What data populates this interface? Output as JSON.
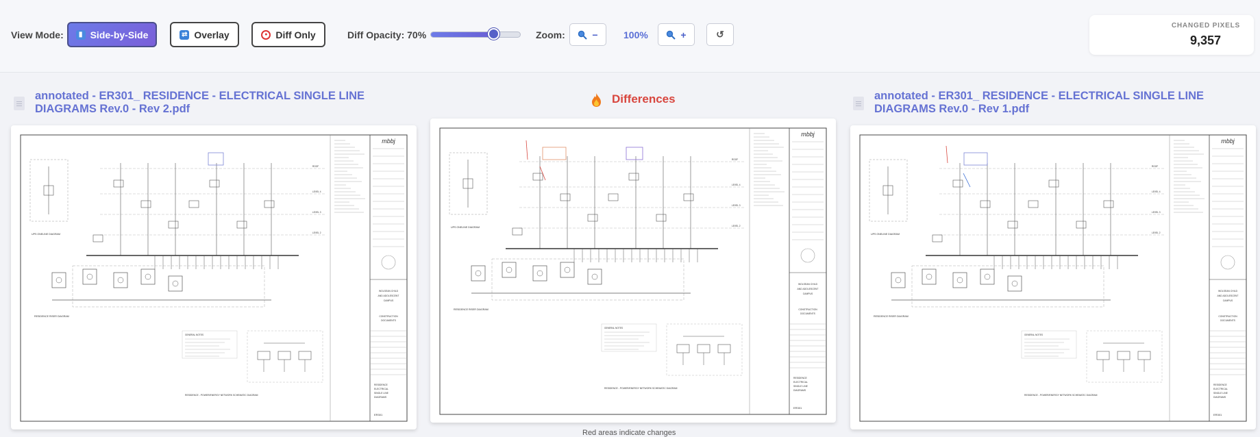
{
  "toolbar": {
    "view_mode_label": "View Mode:",
    "modes": [
      {
        "label": "Side-by-Side",
        "icon": "bar-chart-icon",
        "active": true
      },
      {
        "label": "Overlay",
        "icon": "shuffle-icon",
        "active": false
      },
      {
        "label": "Diff Only",
        "icon": "target-icon",
        "active": false
      }
    ],
    "opacity_label": "Diff Opacity: 70%",
    "opacity_value": 0.7,
    "zoom_label": "Zoom:",
    "zoom_out_label": "−",
    "zoom_value": "100%",
    "zoom_in_label": "+",
    "reset_label": "↺"
  },
  "stats": {
    "changed_pixels_label": "CHANGED PIXELS",
    "changed_pixels_value": "9,357"
  },
  "panels": {
    "left": {
      "filename": "annotated - ER301_ RESIDENCE - ELECTRICAL SINGLE LINE DIAGRAMS Rev.0 - Rev 2.pdf"
    },
    "middle": {
      "title": "Differences",
      "caption": "Red areas indicate changes"
    },
    "right": {
      "filename": "annotated - ER301_ RESIDENCE - ELECTRICAL SINGLE LINE DIAGRAMS Rev.0 - Rev 1.pdf"
    }
  },
  "drawing": {
    "logo": "mbbj",
    "client": "WOLSEAN CHILD AND ADOLESCENT CAMPUS",
    "status": "CONSTRUCTION DOCUMENTS",
    "title": "RESIDENCE ELECTRICAL SINGLE LINE DIAGRAMS",
    "number": "ER301",
    "one_line_label": "UPS ONELINE DIAGRAM",
    "riser_label": "RESIDENCE RISER DIAGRAM",
    "network_label": "RESIDENCE - POWER/ENERGY NETWORK SCHEMATIC DIAGRAM",
    "note_label": "GENERAL NOTES",
    "level_labels": [
      "ROOF",
      "LEVEL 4",
      "LEVEL 3",
      "LEVEL 2"
    ]
  },
  "colors": {
    "accent": "#6572d3",
    "diff": "#d8463e",
    "highlight": "#7b86d6"
  }
}
